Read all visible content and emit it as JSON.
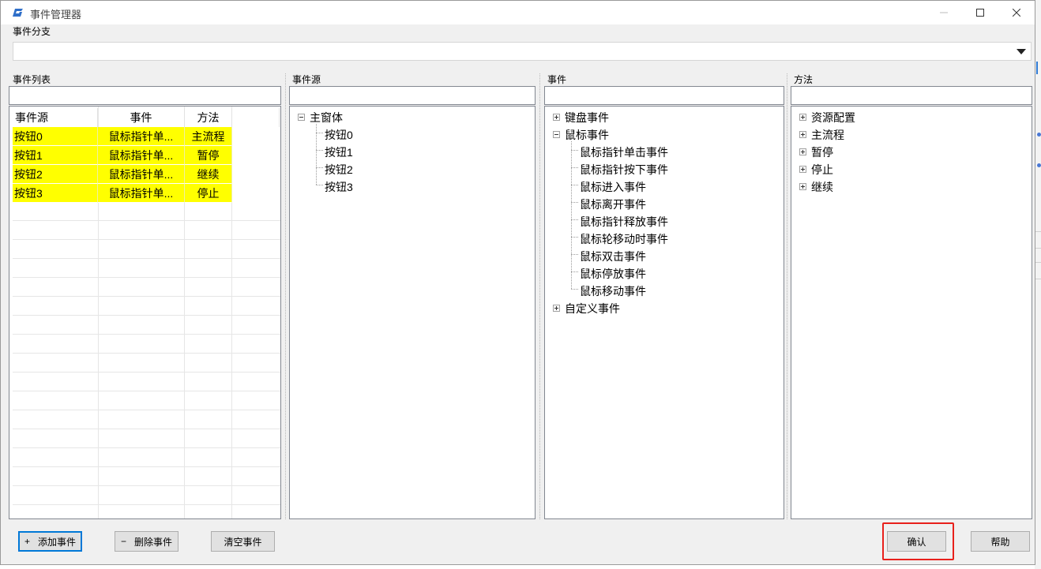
{
  "window": {
    "title": "事件管理器"
  },
  "branch": {
    "label": "事件分支",
    "value": ""
  },
  "event_list": {
    "label": "事件列表",
    "columns": [
      "事件源",
      "事件",
      "方法"
    ],
    "rows": [
      {
        "source": "按钮0",
        "event": "鼠标指针单...",
        "method": "主流程"
      },
      {
        "source": "按钮1",
        "event": "鼠标指针单...",
        "method": "暂停"
      },
      {
        "source": "按钮2",
        "event": "鼠标指针单...",
        "method": "继续"
      },
      {
        "source": "按钮3",
        "event": "鼠标指针单...",
        "method": "停止"
      }
    ],
    "highlight_color": "#ffff00"
  },
  "source_panel": {
    "label": "事件源",
    "root": "主窗体",
    "children": [
      "按钮0",
      "按钮1",
      "按钮2",
      "按钮3"
    ]
  },
  "event_panel": {
    "label": "事件",
    "groups": [
      {
        "name": "键盘事件",
        "expanded": false
      },
      {
        "name": "鼠标事件",
        "expanded": true,
        "children": [
          "鼠标指针单击事件",
          "鼠标指针按下事件",
          "鼠标进入事件",
          "鼠标离开事件",
          "鼠标指针释放事件",
          "鼠标轮移动时事件",
          "鼠标双击事件",
          "鼠标停放事件",
          "鼠标移动事件"
        ]
      },
      {
        "name": "自定义事件",
        "expanded": false
      }
    ]
  },
  "method_panel": {
    "label": "方法",
    "items": [
      "资源配置",
      "主流程",
      "暂停",
      "停止",
      "继续"
    ]
  },
  "buttons": {
    "add_symbol": "+",
    "add": "添加事件",
    "delete_symbol": "−",
    "delete": "删除事件",
    "clear": "清空事件",
    "confirm": "确认",
    "help": "帮助"
  },
  "colors": {
    "accent": "#0078d7",
    "highlight_box": "#e8211c"
  }
}
